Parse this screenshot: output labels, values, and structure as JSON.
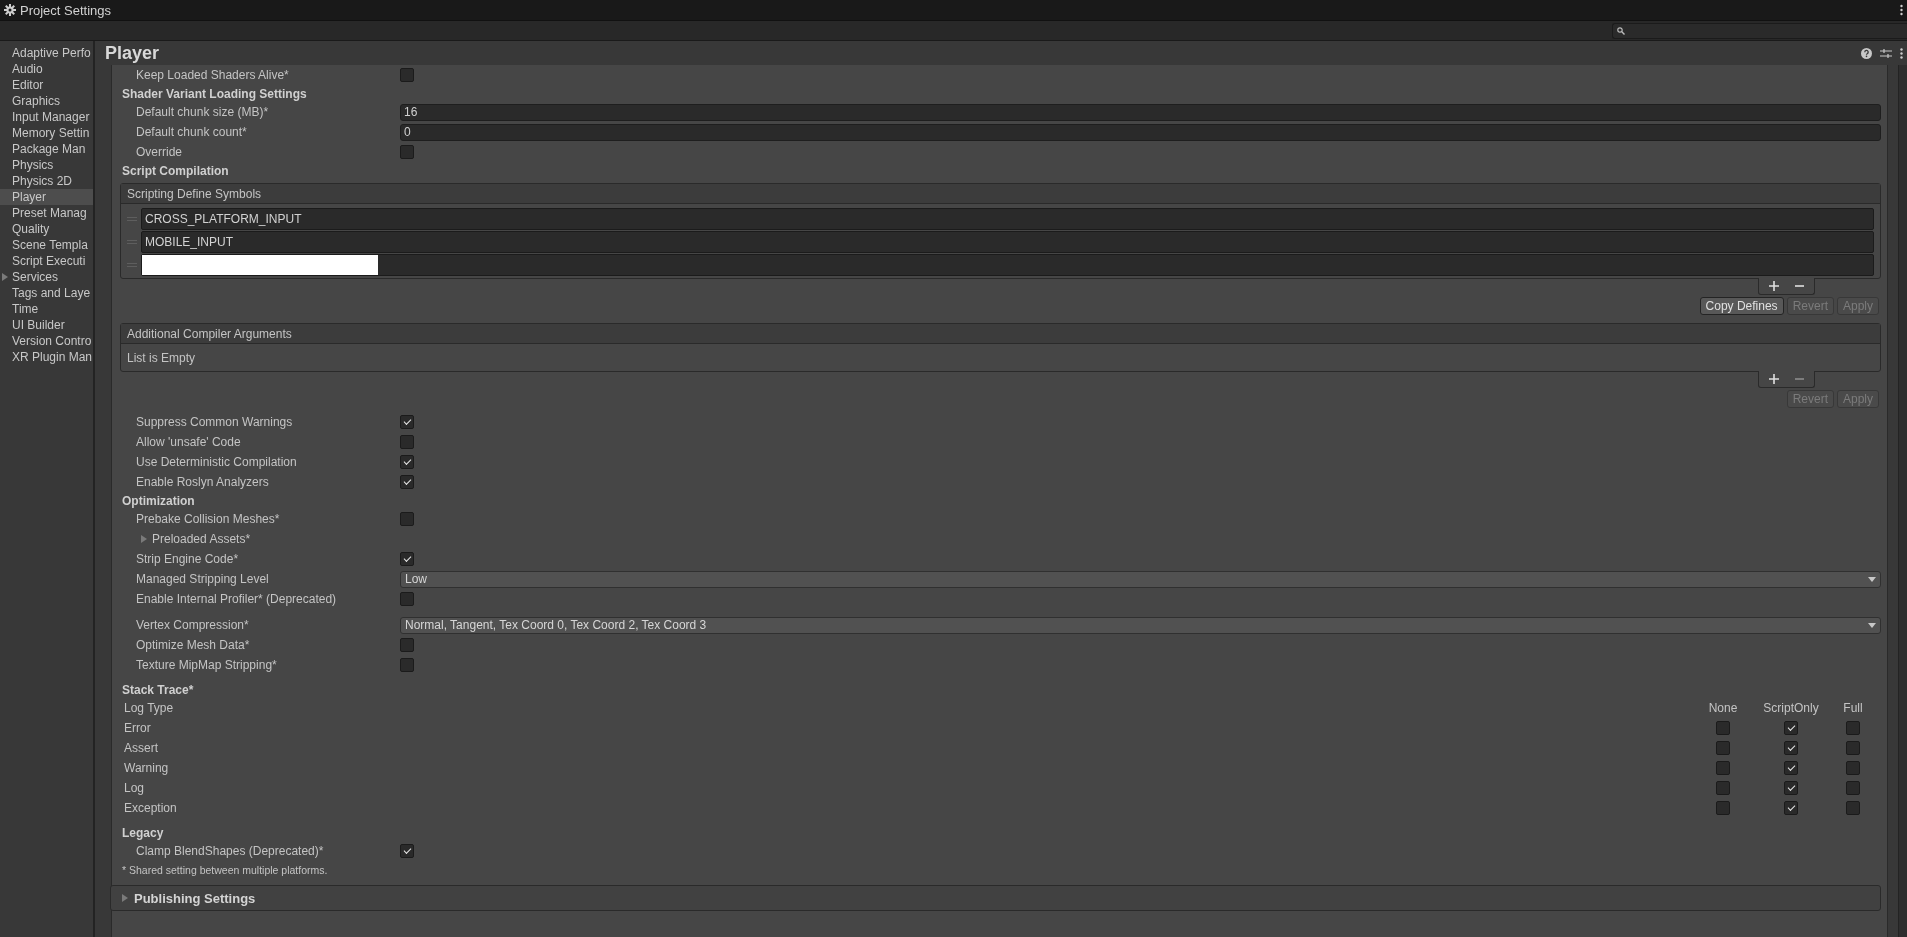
{
  "window": {
    "title": "Project Settings"
  },
  "sidebar": {
    "items": [
      {
        "label": "Adaptive Perfo",
        "selected": false,
        "kind": "page"
      },
      {
        "label": "Audio",
        "selected": false,
        "kind": "page"
      },
      {
        "label": "Editor",
        "selected": false,
        "kind": "page"
      },
      {
        "label": "Graphics",
        "selected": false,
        "kind": "page"
      },
      {
        "label": "Input Manager",
        "selected": false,
        "kind": "page"
      },
      {
        "label": "Memory Settin",
        "selected": false,
        "kind": "page"
      },
      {
        "label": "Package Man",
        "selected": false,
        "kind": "page"
      },
      {
        "label": "Physics",
        "selected": false,
        "kind": "page"
      },
      {
        "label": "Physics 2D",
        "selected": false,
        "kind": "page"
      },
      {
        "label": "Player",
        "selected": true,
        "kind": "page"
      },
      {
        "label": "Preset Manag",
        "selected": false,
        "kind": "page"
      },
      {
        "label": "Quality",
        "selected": false,
        "kind": "page"
      },
      {
        "label": "Scene Templa",
        "selected": false,
        "kind": "page"
      },
      {
        "label": "Script Executi",
        "selected": false,
        "kind": "page"
      },
      {
        "label": "Services",
        "selected": false,
        "kind": "group"
      },
      {
        "label": "Tags and Laye",
        "selected": false,
        "kind": "page"
      },
      {
        "label": "Time",
        "selected": false,
        "kind": "page"
      },
      {
        "label": "UI Builder",
        "selected": false,
        "kind": "page"
      },
      {
        "label": "Version Contro",
        "selected": false,
        "kind": "page"
      },
      {
        "label": "XR Plugin Man",
        "selected": false,
        "kind": "page"
      }
    ]
  },
  "page": {
    "title": "Player"
  },
  "settings": [
    {
      "kind": "checkbox",
      "label": "Keep Loaded Shaders Alive*",
      "checked": false
    },
    {
      "kind": "heading",
      "label": "Shader Variant Loading Settings"
    },
    {
      "kind": "field",
      "label": "Default chunk size (MB)*",
      "value": "16"
    },
    {
      "kind": "field",
      "label": "Default chunk count*",
      "value": "0"
    },
    {
      "kind": "checkbox",
      "label": "Override",
      "checked": false
    },
    {
      "kind": "heading",
      "label": "Script Compilation"
    },
    {
      "kind": "list",
      "title": "Scripting Define Symbols",
      "remove_enabled": true,
      "entries": [
        {
          "text": "CROSS_PLATFORM_INPUT",
          "editing": false
        },
        {
          "text": "MOBILE_INPUT",
          "editing": false
        },
        {
          "editing": true
        }
      ],
      "buttons": [
        {
          "label": "Copy Defines",
          "disabled": false
        },
        {
          "label": "Revert",
          "disabled": true
        },
        {
          "label": "Apply",
          "disabled": true
        }
      ]
    },
    {
      "kind": "list",
      "title": "Additional Compiler Arguments",
      "remove_enabled": false,
      "empty_text": "List is Empty",
      "buttons": [
        {
          "label": "Revert",
          "disabled": true
        },
        {
          "label": "Apply",
          "disabled": true
        }
      ]
    },
    {
      "kind": "checkbox",
      "label": "Suppress Common Warnings",
      "checked": true
    },
    {
      "kind": "checkbox",
      "label": "Allow 'unsafe' Code",
      "checked": false
    },
    {
      "kind": "checkbox",
      "label": "Use Deterministic Compilation",
      "checked": true
    },
    {
      "kind": "checkbox",
      "label": "Enable Roslyn Analyzers",
      "checked": true
    },
    {
      "kind": "heading",
      "label": "Optimization"
    },
    {
      "kind": "checkbox",
      "label": "Prebake Collision Meshes*",
      "checked": false
    },
    {
      "kind": "foldout",
      "label": "Preloaded Assets*",
      "expanded": false
    },
    {
      "kind": "checkbox",
      "label": "Strip Engine Code*",
      "checked": true
    },
    {
      "kind": "dropdown",
      "label": "Managed Stripping Level",
      "value": "Low"
    },
    {
      "kind": "checkbox",
      "label": "Enable Internal Profiler* (Deprecated)",
      "checked": false
    },
    {
      "kind": "dropdown",
      "label": "Vertex Compression*",
      "value": "Normal, Tangent, Tex Coord 0, Tex Coord 2, Tex Coord 3"
    },
    {
      "kind": "checkbox",
      "label": "Optimize Mesh Data*",
      "checked": false
    },
    {
      "kind": "checkbox",
      "label": "Texture MipMap Stripping*",
      "checked": false
    },
    {
      "kind": "stack_trace",
      "title": "Stack Trace*",
      "column_title": "Log Type",
      "options": [
        "None",
        "ScriptOnly",
        "Full"
      ],
      "rows": [
        {
          "label": "Error",
          "cells": [
            {
              "checked": false
            },
            {
              "checked": true
            },
            {
              "checked": false
            }
          ]
        },
        {
          "label": "Assert",
          "cells": [
            {
              "checked": false
            },
            {
              "checked": true
            },
            {
              "checked": false
            }
          ]
        },
        {
          "label": "Warning",
          "cells": [
            {
              "checked": false
            },
            {
              "checked": true
            },
            {
              "checked": false
            }
          ]
        },
        {
          "label": "Log",
          "cells": [
            {
              "checked": false
            },
            {
              "checked": true
            },
            {
              "checked": false
            }
          ]
        },
        {
          "label": "Exception",
          "cells": [
            {
              "checked": false
            },
            {
              "checked": true
            },
            {
              "checked": false
            }
          ]
        }
      ]
    },
    {
      "kind": "heading",
      "label": "Legacy"
    },
    {
      "kind": "checkbox",
      "label": "Clamp BlendShapes (Deprecated)*",
      "checked": true
    },
    {
      "kind": "note",
      "label": "* Shared setting between multiple platforms."
    }
  ],
  "sections": [
    {
      "label": "Publishing Settings",
      "expanded": false
    }
  ]
}
